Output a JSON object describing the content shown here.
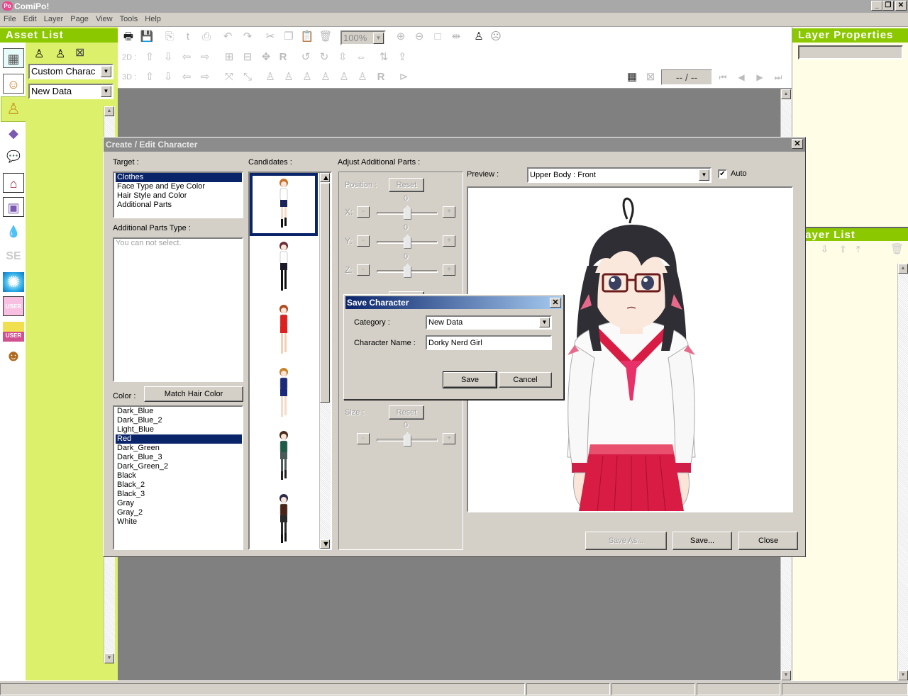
{
  "window": {
    "title": "ComiPo!",
    "logo": "Po",
    "minimize": "_",
    "restore": "❐",
    "close": "✕"
  },
  "menu": [
    "File",
    "Edit",
    "Layer",
    "Page",
    "View",
    "Tools",
    "Help"
  ],
  "asset_panel": {
    "title": "Asset List",
    "category_select": "Custom Charac",
    "data_select": "New Data",
    "tabs": [
      {
        "name": "panel-layout",
        "icon": "▦"
      },
      {
        "name": "character-2d",
        "icon": "☺"
      },
      {
        "name": "character",
        "icon": "♙"
      },
      {
        "name": "3d-object",
        "icon": "◆"
      },
      {
        "name": "speech-balloon",
        "icon": "💬"
      },
      {
        "name": "background",
        "icon": "⌂"
      },
      {
        "name": "object",
        "icon": "▣"
      },
      {
        "name": "effect-drop",
        "icon": "💧"
      },
      {
        "name": "sound-effect",
        "icon": "SE"
      },
      {
        "name": "flash-effect",
        "icon": "✺"
      },
      {
        "name": "user-image",
        "icon": "USER"
      },
      {
        "name": "user-3d",
        "icon": "USER"
      },
      {
        "name": "character-box",
        "icon": "☻"
      }
    ]
  },
  "toolbar": {
    "zoom": "100%",
    "label_2d": "2D :",
    "label_3d": "3D :",
    "page_counter": "-- / --"
  },
  "right_panel": {
    "layer_properties_title": "Layer Properties",
    "layer_list_title": "Layer List"
  },
  "edit_dialog": {
    "title": "Create / Edit Character",
    "close": "✕",
    "target_label": "Target :",
    "target_items": [
      "Clothes",
      "Face Type and Eye Color",
      "Hair Style and Color",
      "Additional Parts"
    ],
    "target_selected": 0,
    "additional_parts_type_label": "Additional Parts Type :",
    "additional_parts_placeholder": "You can not select.",
    "color_label": "Color :",
    "match_hair_color": "Match Hair Color",
    "color_items": [
      "Dark_Blue",
      "Dark_Blue_2",
      "Light_Blue",
      "Red",
      "Dark_Green",
      "Dark_Blue_3",
      "Dark_Green_2",
      "Black",
      "Black_2",
      "Black_3",
      "Gray",
      "Gray_2",
      "White"
    ],
    "color_selected": 3,
    "candidates_label": "Candidates :",
    "candidates": [
      {
        "hair": "#c8722a",
        "top": "#ffffff",
        "bottom": "#1a2458",
        "legs": "#f5dcc8",
        "socks": "#111111"
      },
      {
        "hair": "#6a2e3a",
        "top": "#ffffff",
        "bottom": "#1a1a2a",
        "legs": "#111111",
        "socks": "#111111"
      },
      {
        "hair": "#b04a20",
        "top": "#e02020",
        "bottom": "#e02020",
        "legs": "#f5d0b8",
        "socks": "#f5d0b8"
      },
      {
        "hair": "#c8822a",
        "top": "#1a2a7a",
        "bottom": "#1a2a7a",
        "legs": "#f5dcc8",
        "socks": "#f5dcc8"
      },
      {
        "hair": "#4a2a1a",
        "top": "#1e5a48",
        "bottom": "#4a5a58",
        "legs": "#4a5a58",
        "socks": "#222222"
      },
      {
        "hair": "#2a2a4a",
        "top": "#4a2418",
        "bottom": "#2a2a2a",
        "legs": "#2a2a2a",
        "socks": "#111111"
      }
    ],
    "candidate_selected": 0,
    "adjust_label": "Adjust Additional Parts :",
    "position_label": "Position :",
    "reset_label": "Reset",
    "axes": [
      {
        "label": "X:",
        "value": "0"
      },
      {
        "label": "Y:",
        "value": "0"
      },
      {
        "label": "Z:",
        "value": "0"
      }
    ],
    "size_label": "Size :",
    "size_value": "0",
    "minus": "-",
    "plus": "+",
    "preview_label": "Preview :",
    "preview_select": "Upper Body : Front",
    "auto_label": "Auto",
    "auto_checked": true,
    "save_as": "Save As...",
    "save": "Save...",
    "close_btn": "Close"
  },
  "save_dialog": {
    "title": "Save Character",
    "close": "✕",
    "category_label": "Category :",
    "category_value": "New Data",
    "name_label": "Character Name :",
    "name_value": "Dorky Nerd Girl",
    "save": "Save",
    "cancel": "Cancel"
  }
}
